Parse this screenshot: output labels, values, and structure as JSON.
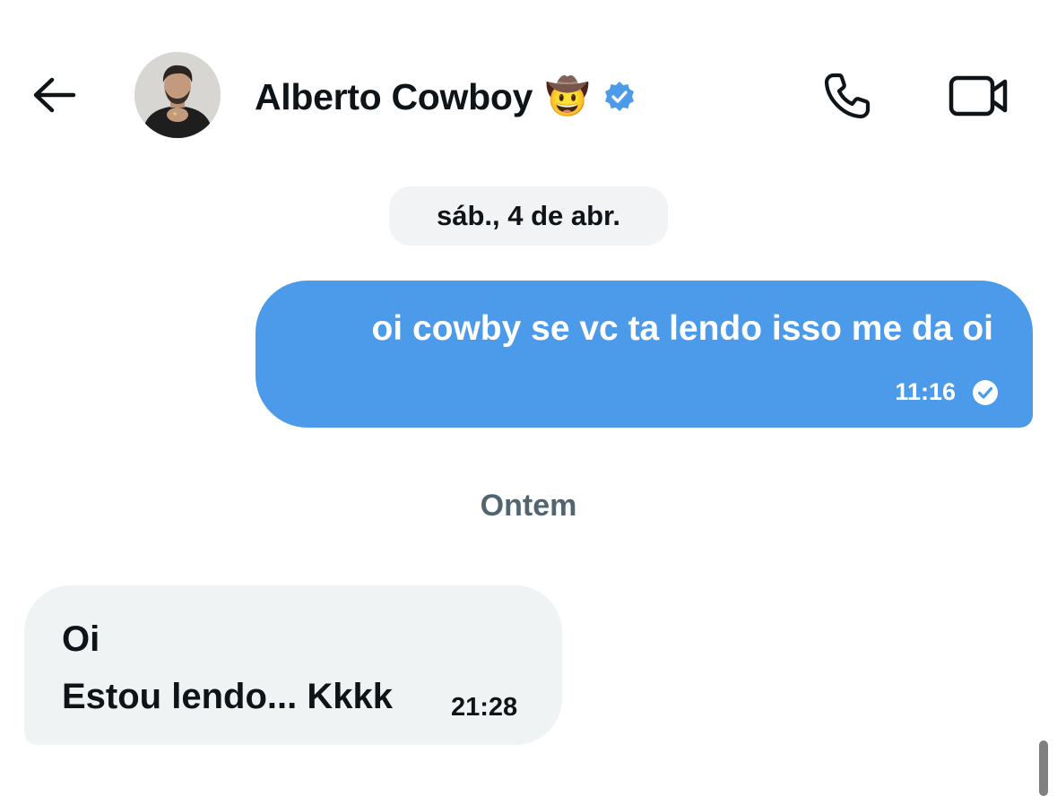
{
  "header": {
    "contact_name": "Alberto Cowboy",
    "name_emoji": "🤠",
    "back_icon": "arrow-left-icon",
    "verified_icon": "verified-badge-icon",
    "call_icon": "phone-icon",
    "video_icon": "video-camera-icon"
  },
  "conversation": {
    "date_separator": "sáb., 4 de abr.",
    "outgoing_message": {
      "text": "oi cowby se vc ta lendo isso me da oi",
      "time": "11:16",
      "status_icon": "read-check-icon"
    },
    "day_separator": "Ontem",
    "incoming_message": {
      "line1": "Oi",
      "line2": "Estou lendo... Kkkk",
      "time": "21:28"
    }
  },
  "colors": {
    "outgoing_bubble": "#4c9aea",
    "incoming_bubble": "#eff3f4",
    "verified_blue": "#4c9aea",
    "secondary_text": "#536471"
  }
}
